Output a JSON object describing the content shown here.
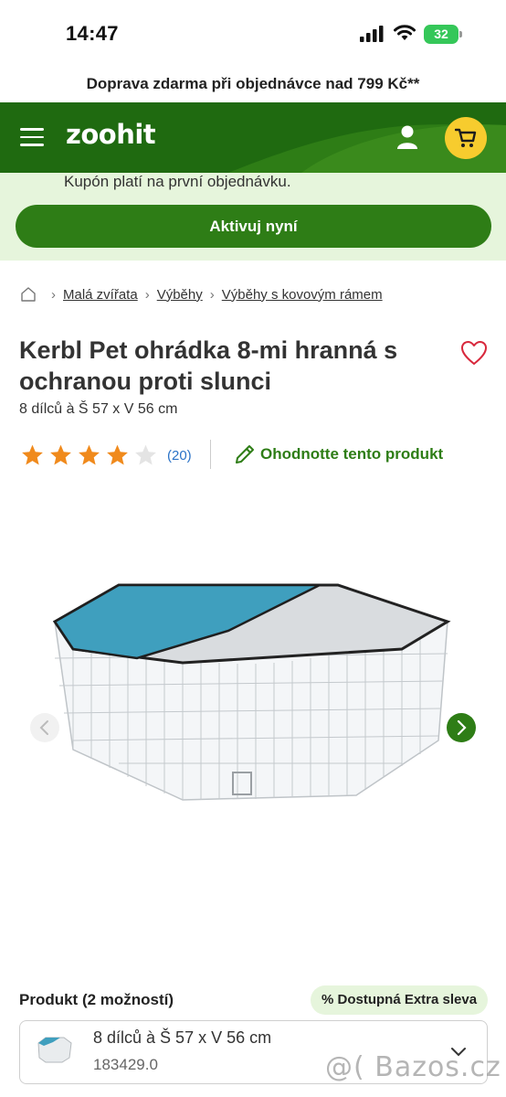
{
  "status_bar": {
    "time": "14:47",
    "battery": "32",
    "icons": [
      "cellular-signal-icon",
      "wifi-icon",
      "battery-icon"
    ]
  },
  "promo": {
    "text": "Doprava zdarma při objednávce nad 799 Kč**"
  },
  "header": {
    "logo": "zoohit",
    "colors": {
      "brand_green": "#2e7d16",
      "cart_yellow": "#f7cc2e"
    },
    "icons": [
      "menu-icon",
      "user-icon",
      "cart-icon"
    ]
  },
  "coupon": {
    "text": "Kupón platí na první objednávku.",
    "button_label": "Aktivuj nyní"
  },
  "breadcrumb": {
    "items": [
      "Malá zvířata",
      "Výběhy",
      "Výběhy s kovovým rámem"
    ]
  },
  "product": {
    "title": "Kerbl Pet ohrádka 8-mi hranná s ochranou proti slunci",
    "subtitle": "8 dílců à Š 57 x V 56 cm",
    "rating_stars": 4,
    "rating_max": 5,
    "review_count": "(20)",
    "rate_label": "Ohodnotte tento produkt"
  },
  "variants": {
    "label": "Produkt (2 možností)",
    "badge": "% Dostupná Extra sleva",
    "selected": {
      "name": "8 dílců à Š 57 x V 56 cm",
      "code": "183429.0"
    }
  },
  "watermark": "@( Bazos.cz"
}
